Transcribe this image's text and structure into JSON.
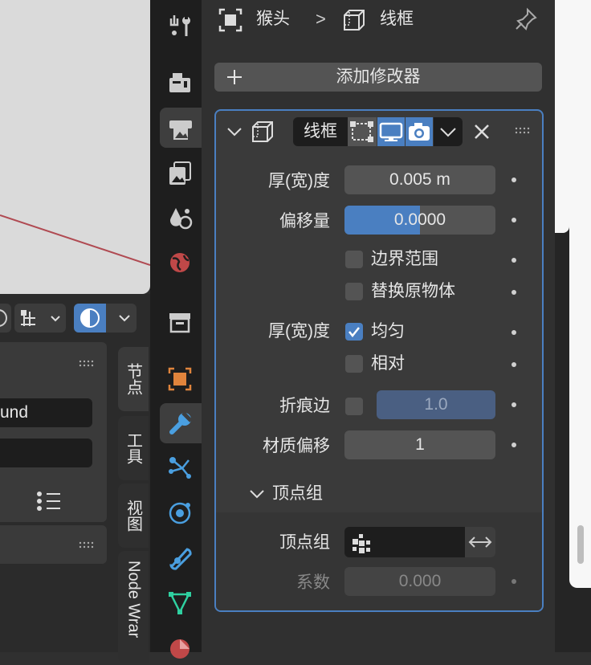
{
  "colors": {
    "accent": "#4a7fc1",
    "bg": "#303030",
    "field": "#545454",
    "viewport": "#dadada",
    "object_orange": "#e0843c",
    "modifier_blue": "#4a9fe0"
  },
  "left": {
    "field_1_text": "und",
    "tabs": [
      {
        "label": "节点"
      },
      {
        "label": "工具"
      },
      {
        "label": "视图"
      },
      {
        "label": "Node Wrar"
      }
    ]
  },
  "tabbar": {
    "icons": [
      "tool-icon",
      "render-icon",
      "output-icon",
      "view-layer-icon",
      "scene-icon",
      "world-icon",
      "collection-icon",
      "object-icon",
      "modifier-icon",
      "particles-icon",
      "physics-icon",
      "constraints-icon",
      "data-icon",
      "material-icon"
    ]
  },
  "header": {
    "object_name": "猴头",
    "separator": ">",
    "modifier_name": "线框"
  },
  "add_modifier_label": "添加修改器",
  "modifier": {
    "name": "线框",
    "rows": {
      "thickness_label": "厚(宽)度",
      "thickness_value": "0.005 m",
      "offset_label": "偏移量",
      "offset_value": "0.0000",
      "offset_fill": 0.5,
      "boundary_label": "边界范围",
      "replace_label": "替换原物体",
      "thickness2_label": "厚(宽)度",
      "even_label": "均匀",
      "relative_label": "相对",
      "crease_label": "折痕边",
      "crease_value": "1.0",
      "material_offset_label": "材质偏移",
      "material_offset_value": "1"
    },
    "vertex_group_panel": {
      "title": "顶点组",
      "field_label": "顶点组",
      "factor_label": "系数",
      "factor_value": "0.000"
    }
  }
}
